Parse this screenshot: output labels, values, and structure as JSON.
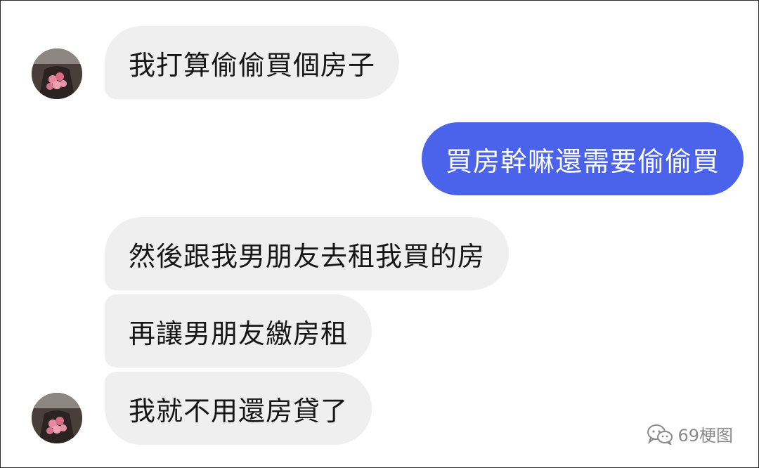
{
  "chat": {
    "messages": [
      {
        "sender": "other",
        "text": "我打算偷偷買個房子"
      },
      {
        "sender": "me",
        "text": "買房幹嘛還需要偷偷買"
      },
      {
        "sender": "other",
        "text": "然後跟我男朋友去租我買的房"
      },
      {
        "sender": "other",
        "text": "再讓男朋友繳房租"
      },
      {
        "sender": "other",
        "text": "我就不用還房貸了"
      }
    ]
  },
  "watermark": {
    "icon": "wechat-icon",
    "text": "69梗图"
  },
  "colors": {
    "outgoing_bubble": "#4a63ea",
    "incoming_bubble": "#efefef",
    "background": "#ffffff"
  }
}
